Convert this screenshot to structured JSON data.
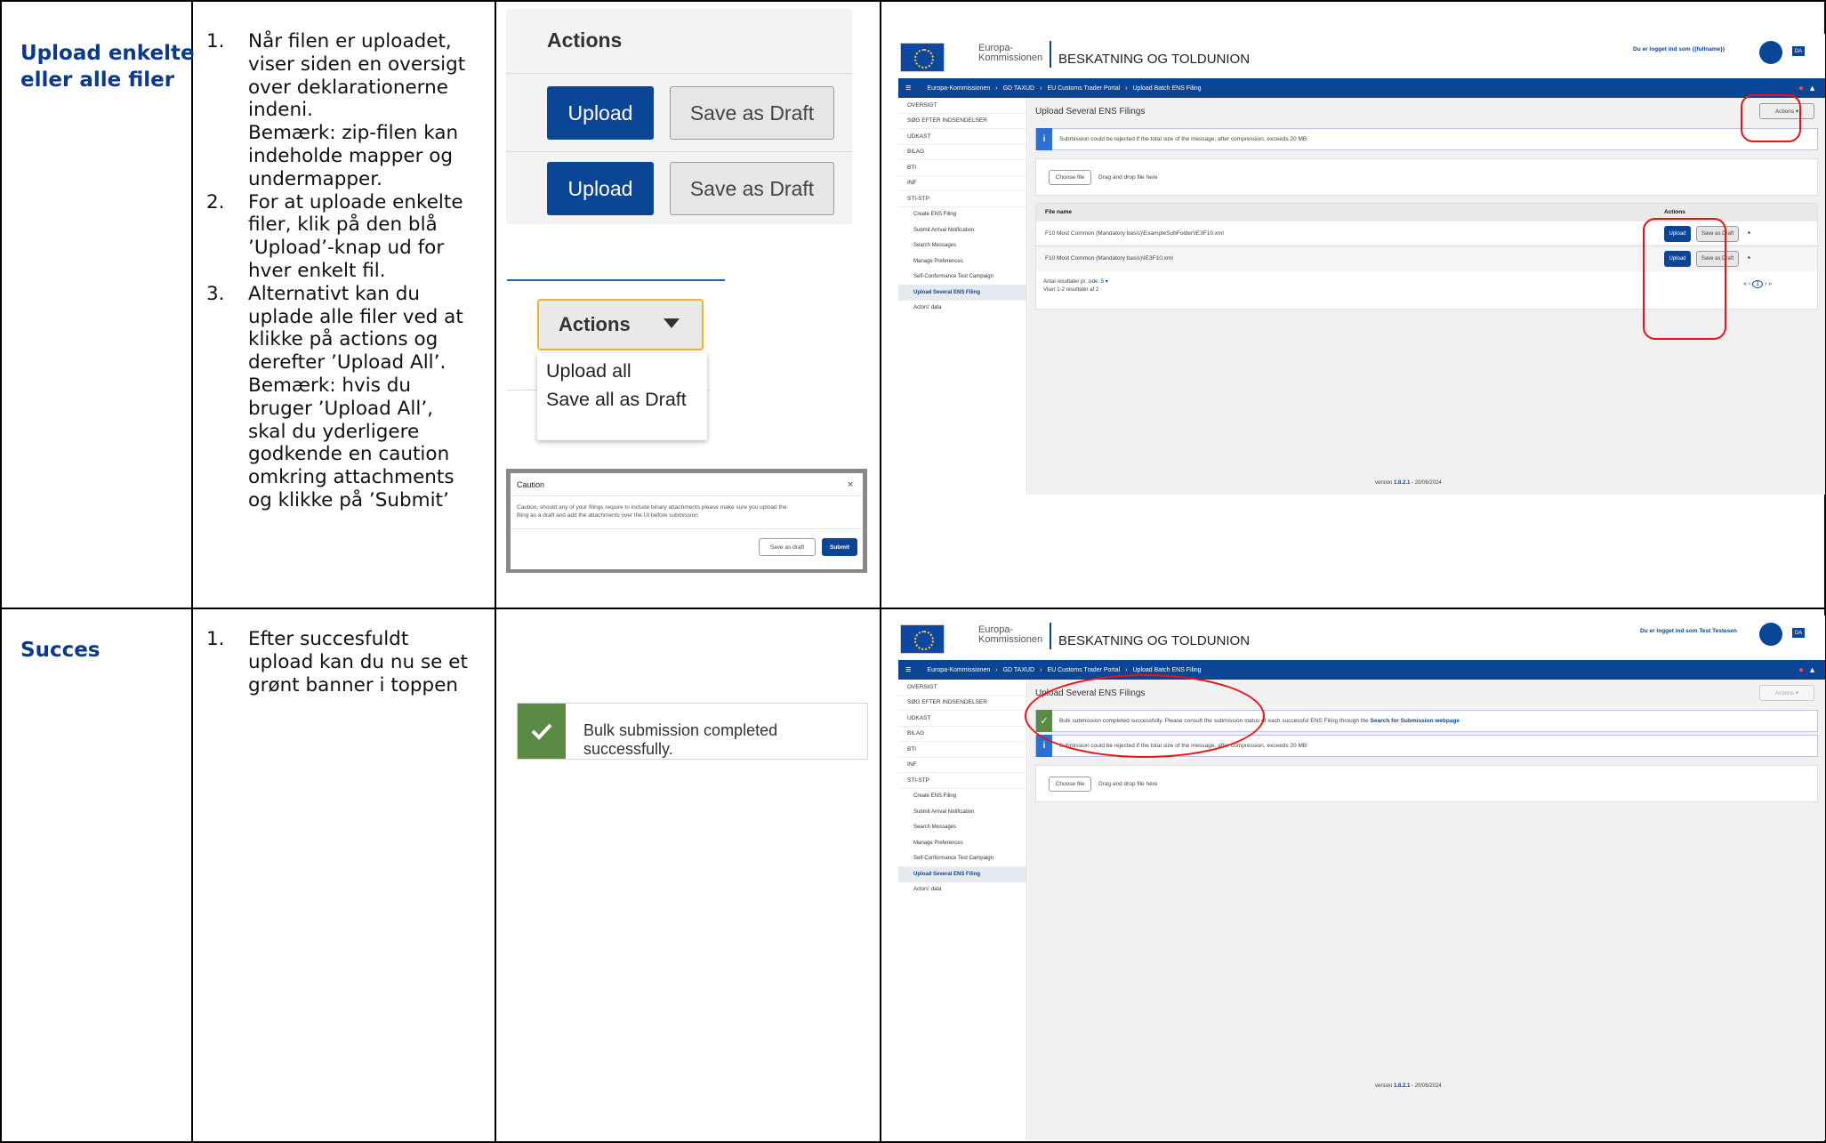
{
  "rows": [
    {
      "title_line1": "Upload enkelte",
      "title_line2": "eller alle filer",
      "steps": [
        {
          "num": "1.",
          "lines": [
            "Når filen er uploadet,",
            "viser siden en oversigt",
            "over deklarationerne",
            "indeni.",
            "Bemærk: zip-filen kan",
            "indeholde mapper og",
            "undermapper."
          ]
        },
        {
          "num": "2.",
          "lines": [
            "For at uploade enkelte",
            "filer, klik på den blå",
            "’Upload’-knap ud for",
            "hver enkelt fil."
          ]
        },
        {
          "num": "3.",
          "lines": [
            "Alternativt kan du",
            "uplade alle filer ved at",
            "klikke på actions og",
            "derefter ’Upload All’.",
            "Bemærk: hvis du",
            "bruger ’Upload All’,",
            "skal du yderligere",
            "godkende en caution",
            "omkring attachments",
            "og klikke på ’Submit’"
          ]
        }
      ]
    },
    {
      "title": "Succes",
      "steps": [
        {
          "num": "1.",
          "lines": [
            "Efter succesfuldt",
            "upload kan du nu se et",
            "grønt banner i toppen"
          ]
        }
      ]
    }
  ],
  "zoom_actions": {
    "header": "Actions",
    "upload": "Upload",
    "save_draft": "Save as Draft"
  },
  "zoom_dropdown": {
    "label": "Actions",
    "items": [
      "Upload all",
      "Save all as Draft"
    ]
  },
  "caution_dialog": {
    "title": "Caution",
    "close": "×",
    "text_line1": "Caution, should any of your filings require to include binary attachments please make sure you upload the",
    "text_line2": "filing as a draft and add the attachments over the UI before submission",
    "save_draft": "Save as draft",
    "submit": "Submit"
  },
  "success_zoom": {
    "text": "Bulk submission completed successfully."
  },
  "portal": {
    "org_line1": "Europa-",
    "org_line2": "Kommissionen",
    "site_title": "BESKATNING OG TOLDUNION",
    "user1": "Du er logget ind som {{fullname}}",
    "user2": "Du er logget ind som Test Testesen",
    "lang": "DA",
    "breadcrumbs": [
      "Europa-Kommissionen",
      "GD TAXUD",
      "EU Customs Trader Portal",
      "Upload Batch ENS Filing"
    ],
    "sidebar": [
      "OVERSIGT",
      "SØG EFTER INDSENDELSER",
      "UDKAST",
      "BILAG",
      "BTI",
      "INF",
      "STI-STP"
    ],
    "sub_items": [
      "Create ENS Filing",
      "Submit Arrival Notification",
      "Search Messages",
      "Manage Preferences",
      "Self-Conformance Test Campaign",
      "Upload Several ENS Filing",
      "Actors' data"
    ],
    "page_title": "Upload Several ENS Filings",
    "actions": "Actions",
    "info": "Submission could be rejected if the total size of the message, after compression, exceeds 20 MB",
    "choose_file": "Choose file",
    "drag_drop": "Drag and drop file here",
    "col_file": "File name",
    "col_actions": "Actions",
    "files": [
      "F10 Most Common (Mandatory basis)\\ExampleSubFolder\\IE3F10.xml",
      "F10 Most Common (Mandatory basis)\\IE3F10.xml"
    ],
    "upload": "Upload",
    "save_draft": "Save as Draft",
    "per_page": "Antal resultater pr. side:",
    "per_page_value": "5",
    "showing": "Viser 1-2 resultater af 2",
    "page_num": "1",
    "version_label": "version",
    "version": "1.8.2.1",
    "version_date": "- 20/06/2024",
    "success_msg": "Bulk submission completed successfully. Please consult the submission status of each successful ENS Filing through the",
    "success_link": "Search for Submission webpage"
  }
}
